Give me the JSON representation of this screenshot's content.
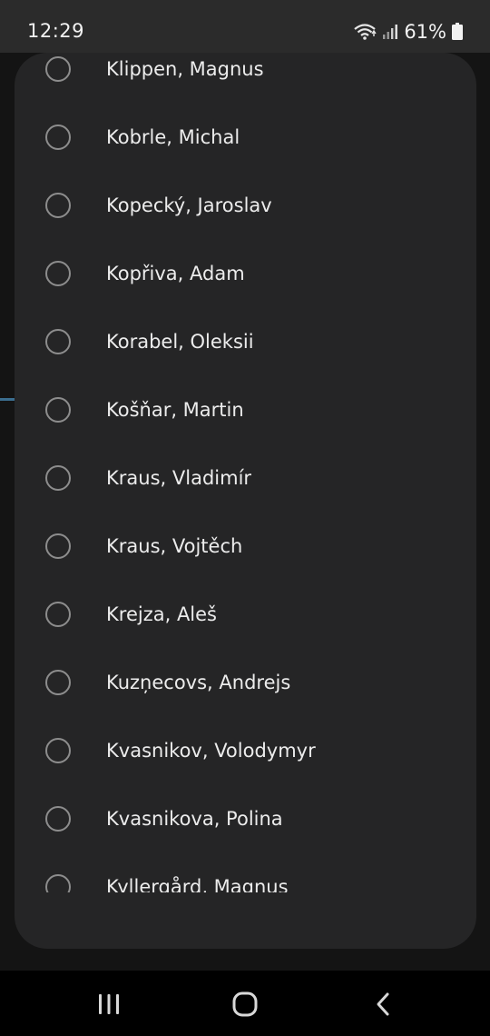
{
  "status_bar": {
    "time": "12:29",
    "battery": "61%",
    "icons": [
      "wifi-icon",
      "signal-icon",
      "battery-icon"
    ]
  },
  "dialog": {
    "items": [
      {
        "label": "Klippen, Magnus",
        "selected": false
      },
      {
        "label": "Kobrle, Michal",
        "selected": false
      },
      {
        "label": "Kopecký, Jaroslav",
        "selected": false
      },
      {
        "label": "Kopřiva, Adam",
        "selected": false
      },
      {
        "label": "Korabel, Oleksii",
        "selected": false
      },
      {
        "label": "Košňar, Martin",
        "selected": false
      },
      {
        "label": "Kraus, Vladimír",
        "selected": false
      },
      {
        "label": "Kraus, Vojtěch",
        "selected": false
      },
      {
        "label": "Krejza, Aleš",
        "selected": false
      },
      {
        "label": "Kuzņecovs, Andrejs",
        "selected": false
      },
      {
        "label": "Kvasnikov, Volodymyr",
        "selected": false
      },
      {
        "label": "Kvasnikova, Polina",
        "selected": false
      },
      {
        "label": "Kyllergård, Magnus",
        "selected": false
      }
    ]
  },
  "nav_bar": {
    "buttons": [
      "recents-icon",
      "home-icon",
      "back-icon"
    ]
  },
  "colors": {
    "dialog_bg": "#252526",
    "radio_border": "#8d8d8d",
    "text": "#ececec"
  }
}
